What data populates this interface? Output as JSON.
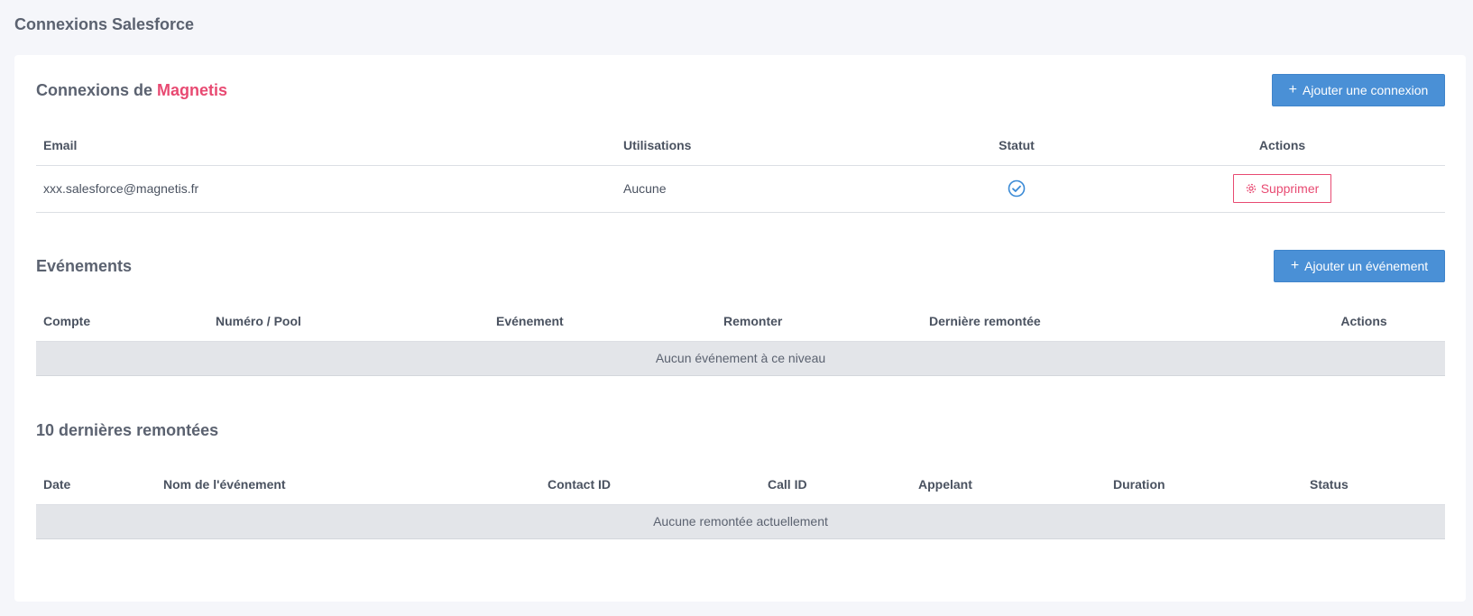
{
  "page": {
    "title": "Connexions Salesforce"
  },
  "connections": {
    "title_prefix": "Connexions de",
    "title_brand": "Magnetis",
    "add_button_label": "Ajouter une connexion",
    "columns": [
      "Email",
      "Utilisations",
      "Statut",
      "Actions"
    ],
    "rows": [
      {
        "email": "xxx.salesforce@magnetis.fr",
        "usage": "Aucune",
        "status_icon": "check-circle-icon",
        "delete_label": "Supprimer"
      }
    ]
  },
  "events": {
    "title": "Evénements",
    "add_button_label": "Ajouter un événement",
    "columns": [
      "Compte",
      "Numéro / Pool",
      "Evénement",
      "Remonter",
      "Dernière remontée",
      "Actions"
    ],
    "empty_text": "Aucun événement à ce niveau"
  },
  "recent": {
    "title": "10 dernières remontées",
    "columns": [
      "Date",
      "Nom de l'événement",
      "Contact ID",
      "Call ID",
      "Appelant",
      "Duration",
      "Status"
    ],
    "empty_text": "Aucune remontée actuellement"
  },
  "colors": {
    "brand_pink": "#e84a72",
    "primary_blue": "#4a90d6",
    "status_check": "#3a8ad6"
  }
}
